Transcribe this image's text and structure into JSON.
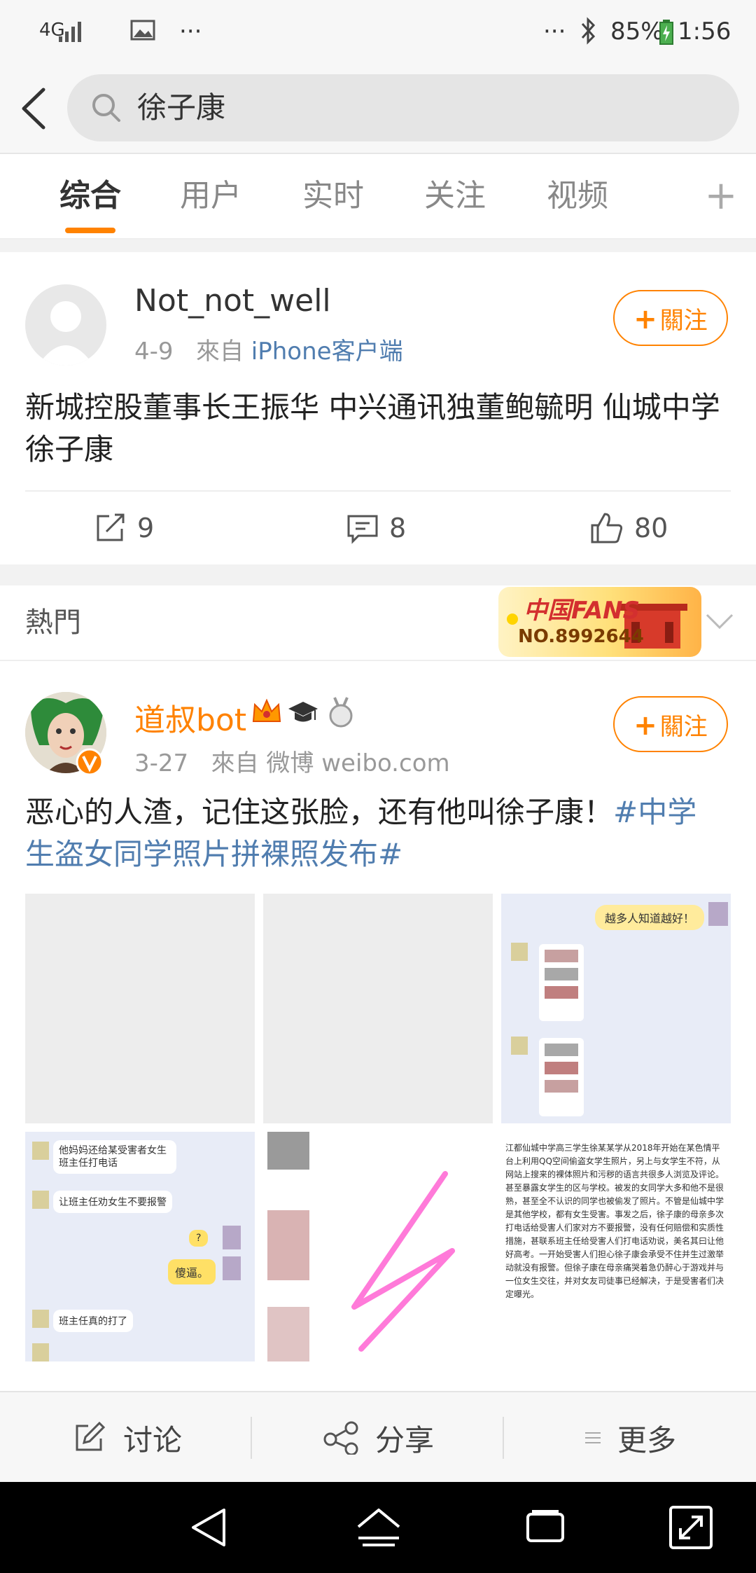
{
  "status_bar": {
    "network": "4G",
    "more_left": "···",
    "more_right": "···",
    "battery": "85%",
    "time": "1:56"
  },
  "search": {
    "query": "徐子康"
  },
  "tabs": [
    {
      "label": "综合",
      "active": true
    },
    {
      "label": "用户",
      "active": false
    },
    {
      "label": "实时",
      "active": false
    },
    {
      "label": "关注",
      "active": false
    },
    {
      "label": "视频",
      "active": false
    }
  ],
  "tab_plus": "+",
  "post1": {
    "username": "Not_not_well",
    "date": "4-9",
    "source_prefix": "來自",
    "source": "iPhone客户端",
    "follow_label": "關注",
    "text": "新城控股董事长王振华 中兴通讯独董鲍毓明 仙城中学徐子康",
    "reposts": "9",
    "comments": "8",
    "likes": "80"
  },
  "hot_section": {
    "label": "熱門",
    "badge_title": "中国FANS",
    "badge_number": "NO.8992644"
  },
  "post2": {
    "username": "道叔bot",
    "date": "3-27",
    "source_prefix": "來自",
    "source": "微博 weibo.com",
    "follow_label": "關注",
    "text_plain": "恶心的人渣，记住这张脸，还有他叫徐子康！",
    "hashtag": "#中学生盗女同学照片拼裸照发布#",
    "chat_top_bubble": "越多人知道越好！",
    "chat2": {
      "msg1": "他妈妈还给某受害者女生班主任打电话",
      "msg2": "让班主任劝女生不要报警",
      "msg3": "?",
      "msg4": "傻逼。",
      "msg5": "班主任真的打了"
    },
    "doc_text": "江都仙城中学高三学生徐某某学从2018年开始在某色情平台上利用QQ空间偷盗女学生照片，另上与女学生不符，从网站上搜来的裸体照片和污秽的语言共很多人浏览及评论。甚至暴露女学生的区与学校。被发的女同学大多和他不是很熟，甚至全不认识的同学也被偷发了照片。不管是仙城中学是其他学校，都有女生受害。事发之后，徐子康的母亲多次打电话给受害人们家对方不要报警，没有任何赔偿和实质性措施，甚联系班主任给受害人们打电话劝说，美名其曰让他好高考。一开始受害人们担心徐子康会承受不住并生过激举动就没有报警。但徐子康在母亲痛哭着急仍醉心于游戏并与一位女生交往，并对女友司徒事已经解决，于是受害者们决定曝光。"
  },
  "bottom_bar": {
    "discuss": "讨论",
    "share": "分享",
    "more": "更多"
  },
  "colors": {
    "accent": "#ff8200",
    "link": "#507daf"
  }
}
